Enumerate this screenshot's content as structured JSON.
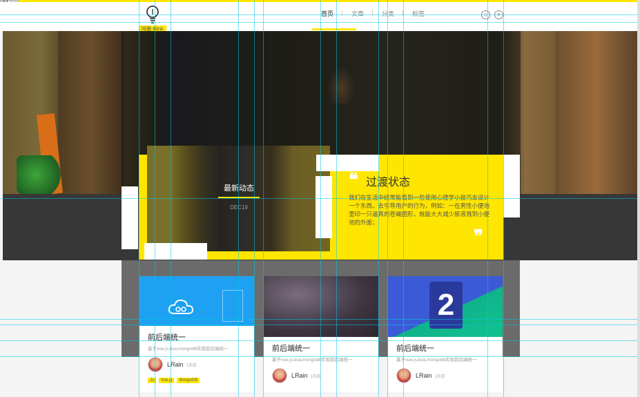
{
  "editor": {
    "label": "01",
    "icon": "image-icon"
  },
  "header": {
    "badge": "阿雅-Blink",
    "nav": [
      {
        "label": "首页",
        "active": true
      },
      {
        "label": "文章",
        "active": false
      },
      {
        "label": "分类",
        "active": false
      },
      {
        "label": "标签",
        "active": false
      }
    ],
    "buttons": {
      "search": "○",
      "add": "+"
    }
  },
  "feature": {
    "title": "最新动态",
    "date": "DEC19",
    "heading": "过渡状态",
    "text": "我们在生活中经常能看到一些使用心理学小技巧去设计一个东西，去引导用户的行为，例如：一在男性小便池里印一只逼真的苍蝇图形，就能大大减少尿液溅到小便池的外面；",
    "quote_open": "❝",
    "quote_close": "❞"
  },
  "cards": [
    {
      "title": "前后端统一",
      "desc": "基于vue.js,koa,mongodb实现前后端统一",
      "author": "LRain",
      "time": "1天前",
      "tags": [
        "Js",
        "Vue.js",
        "MongoDB"
      ]
    },
    {
      "title": "前后端统一",
      "desc": "基于vue.js,koa,mongodb实现前后端统一",
      "author": "LRain",
      "time": "1天前",
      "tags": []
    },
    {
      "title": "前后端统一",
      "desc": "基于vue.js,koa,mongodb实现前后端统一",
      "author": "LRain",
      "time": "1天前",
      "tags": [],
      "image_text": "2"
    }
  ],
  "colors": {
    "accent": "#ffe600",
    "band": "#373737",
    "guide": "#00c8e6"
  }
}
